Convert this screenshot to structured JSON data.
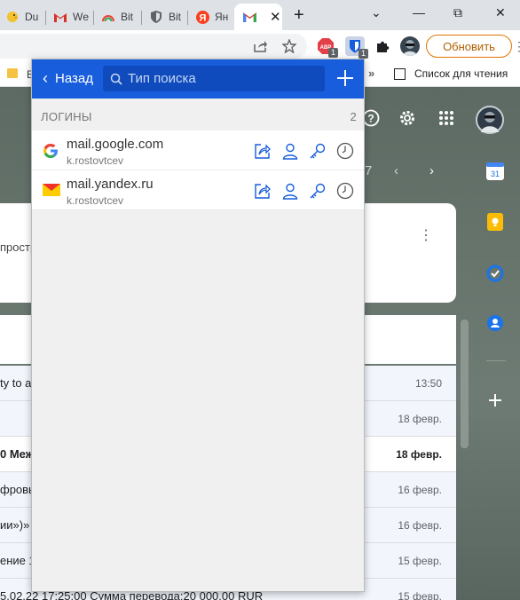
{
  "browser": {
    "tabs": [
      {
        "label": "Du",
        "icon": "duck-icon",
        "color": "#e6b800"
      },
      {
        "label": "Wе",
        "icon": "gmail-icon",
        "color": "#d93025"
      },
      {
        "label": "Bit",
        "icon": "rainbow-icon",
        "color": "#e8710a"
      },
      {
        "label": "Bit",
        "icon": "shield-icon",
        "color": "#5f6368"
      },
      {
        "label": "Ян",
        "icon": "yandex-icon",
        "color": "#fc3f1d"
      }
    ],
    "active_tab": {
      "icon": "gmail-icon",
      "close": "✕"
    },
    "new_tab": "+",
    "window_controls": [
      "⌄",
      "—",
      "⧉",
      "✕"
    ]
  },
  "toolbar": {
    "ext_badges": [
      "1",
      "1"
    ],
    "abp_label": "ABP",
    "update_label": "Обновить",
    "menu": "⋮"
  },
  "bookmarks": {
    "partial": "B",
    "more": "»",
    "reading_list": "Список для чтения"
  },
  "gmail": {
    "nav_partial": "7",
    "card_text": "простр",
    "card_menu": "⋮",
    "rows": [
      {
        "subject": "ty to a",
        "date": "13:50",
        "unread": false
      },
      {
        "subject": "",
        "date": "18 февр.",
        "unread": false
      },
      {
        "subject": "0 Меж",
        "date": "18 февр.",
        "unread": true
      },
      {
        "subject": "фровы",
        "date": "16 февр.",
        "unread": false
      },
      {
        "subject": "ии»)»",
        "date": "16 февр.",
        "unread": false
      },
      {
        "subject": "ение 1",
        "date": "15 февр.",
        "unread": false
      },
      {
        "subject": "5.02.22 17:25:00 Сумма перевода:20 000.00 RUR",
        "date": "15 февр.",
        "unread": false
      }
    ]
  },
  "bitwarden": {
    "back_label": "Назад",
    "search_placeholder": "Тип поиска",
    "section_title": "ЛОГИНЫ",
    "section_count": "2",
    "header_color": "#175ddc",
    "items": [
      {
        "name": "mail.google.com",
        "username": "k.rostovtcev",
        "icon": "google-icon"
      },
      {
        "name": "mail.yandex.ru",
        "username": "k.rostovtcev",
        "icon": "yandex-mail-icon"
      }
    ]
  }
}
